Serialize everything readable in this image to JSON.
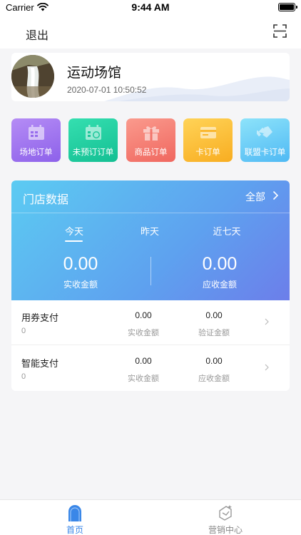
{
  "status_bar": {
    "carrier": "Carrier",
    "time": "9:44 AM"
  },
  "nav": {
    "logout_label": "退出",
    "scan_icon": "scan-icon"
  },
  "profile": {
    "venue_name": "运动场馆",
    "timestamp": "2020-07-01 10:50:52"
  },
  "quick_actions": [
    {
      "label": "场地订单",
      "icon": "calendar-icon",
      "color": "#8d61ea"
    },
    {
      "label": "未预订订单",
      "icon": "calendar-clock-icon",
      "color": "#14bf93"
    },
    {
      "label": "商品订单",
      "icon": "gift-icon",
      "color": "#f0675f"
    },
    {
      "label": "卡订单",
      "icon": "card-icon",
      "color": "#f8ad21"
    },
    {
      "label": "联盟卡订单",
      "icon": "handshake-icon",
      "color": "#4fb9f4"
    }
  ],
  "store": {
    "title": "门店数据",
    "all_label": "全部",
    "tabs": [
      {
        "label": "今天",
        "active": true
      },
      {
        "label": "昨天"
      },
      {
        "label": "近七天"
      }
    ],
    "summary": [
      {
        "value": "0.00",
        "label": "实收金额"
      },
      {
        "value": "0.00",
        "label": "应收金额"
      }
    ],
    "payments": [
      {
        "name": "用券支付",
        "count": "0",
        "col1_value": "0.00",
        "col1_label": "实收金额",
        "col2_value": "0.00",
        "col2_label": "验证金额"
      },
      {
        "name": "智能支付",
        "count": "0",
        "col1_value": "0.00",
        "col1_label": "实收金额",
        "col2_value": "0.00",
        "col2_label": "应收金额"
      }
    ]
  },
  "tabbar": {
    "items": [
      {
        "label": "首页",
        "icon": "home-icon",
        "active": true,
        "color": "#3a87e8"
      },
      {
        "label": "营销中心",
        "icon": "marketing-icon",
        "color": "#888888"
      }
    ]
  }
}
